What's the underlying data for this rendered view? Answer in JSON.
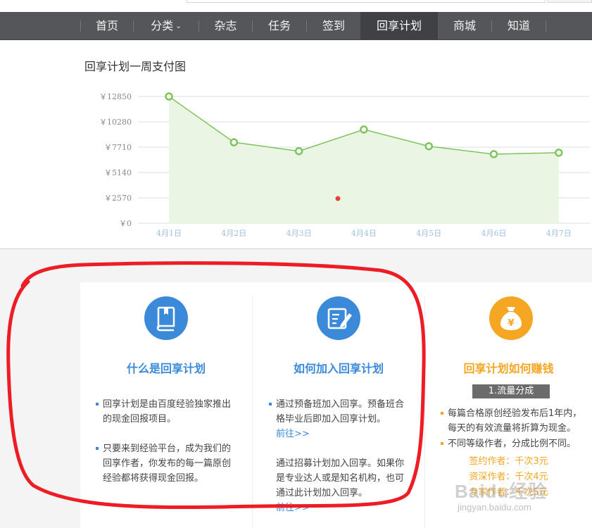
{
  "nav": {
    "items": [
      {
        "label": "首页"
      },
      {
        "label": "分类",
        "caret": "⌄"
      },
      {
        "label": "杂志"
      },
      {
        "label": "任务"
      },
      {
        "label": "签到"
      },
      {
        "label": "回享计划",
        "active": true
      },
      {
        "label": "商城"
      },
      {
        "label": "知道"
      }
    ]
  },
  "chart_title": "回享计划一周支付图",
  "chart_data": {
    "type": "area",
    "categories": [
      "4月1日",
      "4月2日",
      "4月3日",
      "4月4日",
      "4月5日",
      "4月6日",
      "4月7日"
    ],
    "series": [
      {
        "values": [
          12850,
          8200,
          7300,
          9500,
          7800,
          7000,
          7150
        ]
      }
    ],
    "y_ticks": [
      "￥0",
      "￥2570",
      "￥5140",
      "￥7710",
      "￥10280",
      "￥12850"
    ],
    "ylim": [
      0,
      12850
    ],
    "grid": true,
    "line_color": "#7cc55c",
    "fill_color": "#eaf5e4"
  },
  "columns": [
    {
      "icon": "book-icon",
      "color": "#3b8ad9",
      "title": "什么是回享计划",
      "bullets": [
        {
          "text": "回享计划是由百度经验独家推出的现金回报项目。"
        },
        {
          "text": "只要来到经验平台，成为我们的回享作者，你发布的每一篇原创经验都将获得现金回报。"
        }
      ]
    },
    {
      "icon": "edit-document-icon",
      "color": "#3b8ad9",
      "title": "如何加入回享计划",
      "bullets": [
        {
          "text": "通过预备班加入回享。预备班合格毕业后即加入回享计划。",
          "link": "前往>>"
        },
        {
          "text": "通过招募计划加入回享。如果你是专业达人或是知名机构，也可通过此计划加入回享。",
          "link": "前往>>"
        }
      ]
    },
    {
      "icon": "money-bag-icon",
      "color": "#f5a623",
      "title": "回享计划如何赚钱",
      "tag": "1.流量分成",
      "bullets": [
        {
          "text": "每篇合格原创经验发布后1年内，每天的有效流量将折算为现金。"
        },
        {
          "text": "不同等级作者，分成比例不同。"
        }
      ],
      "tiers": [
        "签约作者：千次3元",
        "资深作者：千次4元",
        "专家作者：千次5元"
      ]
    }
  ],
  "watermark": {
    "brand": "Baidu经验",
    "url": "jingyan.baidu.com"
  }
}
